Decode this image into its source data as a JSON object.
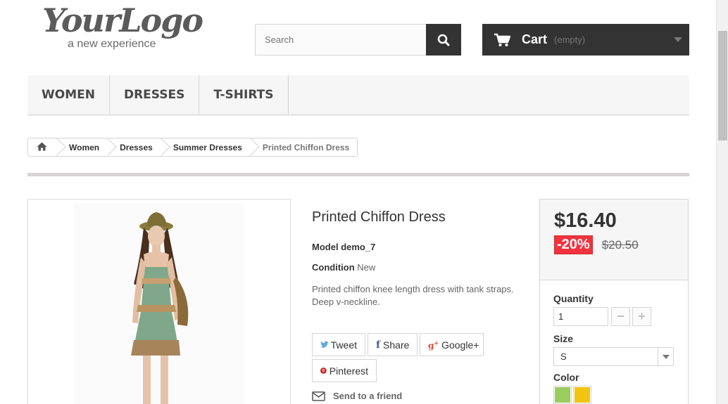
{
  "header": {
    "logo_main": "YourLogo",
    "logo_tagline": "a new experience",
    "search_placeholder": "Search",
    "cart_label": "Cart",
    "cart_status": "(empty)"
  },
  "menu": [
    "WOMEN",
    "DRESSES",
    "T-SHIRTS"
  ],
  "breadcrumb": [
    "Women",
    "Dresses",
    "Summer Dresses",
    "Printed Chiffon Dress"
  ],
  "product": {
    "name": "Printed Chiffon Dress",
    "model_label": "Model",
    "model_value": "demo_7",
    "condition_label": "Condition",
    "condition_value": "New",
    "description": "Printed chiffon knee length dress with tank straps. Deep v-neckline."
  },
  "social": {
    "tweet": "Tweet",
    "share": "Share",
    "google": "Google+",
    "pinterest": "Pinterest"
  },
  "send_to_friend": "Send to a friend",
  "pricing": {
    "price": "$16.40",
    "discount": "-20%",
    "old_price": "$20.50"
  },
  "buy": {
    "quantity_label": "Quantity",
    "quantity_value": "1",
    "size_label": "Size",
    "size_value": "S",
    "color_label": "Color",
    "colors": [
      "#9acd5e",
      "#f1c40f"
    ]
  }
}
